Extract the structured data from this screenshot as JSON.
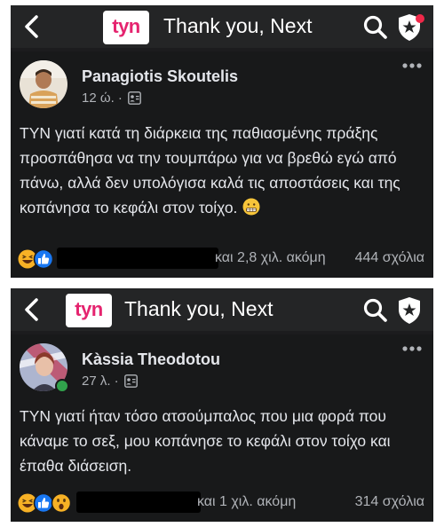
{
  "screenshots": [
    {
      "header": {
        "back_icon": "chevron-left-icon",
        "logo_text": "tyn",
        "group_title": "Thank you, Next",
        "search_icon": "search-icon",
        "badge_icon": "admin-star-badge-icon"
      },
      "post": {
        "author": "Panagiotis Skoutelis",
        "time": "12 ώ. ·",
        "privacy_icon": "group-members-icon",
        "more_icon": "more-horizontal-icon",
        "text": "ΤΥΝ γιατί κατά τη διάρκεια της παθιασμένης πράξης προσπάθησα να την τουμπάρω για να βρεθώ εγώ από πάνω, αλλά δεν υπολόγισα καλά τις αποστάσεις και της κοπάνησα το κεφάλι στον τοίχο.",
        "emoji": "grimacing-face",
        "reactions": [
          "haha",
          "like"
        ],
        "reaction_text": "και 2,8 χιλ. ακόμη",
        "comments": "444 σχόλια"
      }
    },
    {
      "header": {
        "back_icon": "chevron-left-icon",
        "logo_text": "tyn",
        "group_title": "Thank you, Next",
        "search_icon": "search-icon",
        "badge_icon": "admin-star-badge-icon"
      },
      "post": {
        "author": "Kàssia Theodotou",
        "time": "27 λ. ·",
        "privacy_icon": "group-members-icon",
        "more_icon": "more-horizontal-icon",
        "text": "ΤΥΝ γιατί ήταν τόσο ατσούμπαλος που μια φορά που κάναμε το σεξ, μου κοπάνησε το κεφάλι στον τοίχο και έπαθα διάσειση.",
        "reactions": [
          "haha",
          "like",
          "wow"
        ],
        "reaction_text": "και 1 χιλ. ακόμη",
        "comments": "314 σχόλια"
      }
    }
  ],
  "colors": {
    "background": "#18191a",
    "header": "#242526",
    "text": "#e4e6eb",
    "secondary_text": "#b0b3b8",
    "logo_pink": "#e5246f",
    "like_blue": "#1877f2",
    "haha_yellow": "#f7b125",
    "online_green": "#31a24c"
  }
}
